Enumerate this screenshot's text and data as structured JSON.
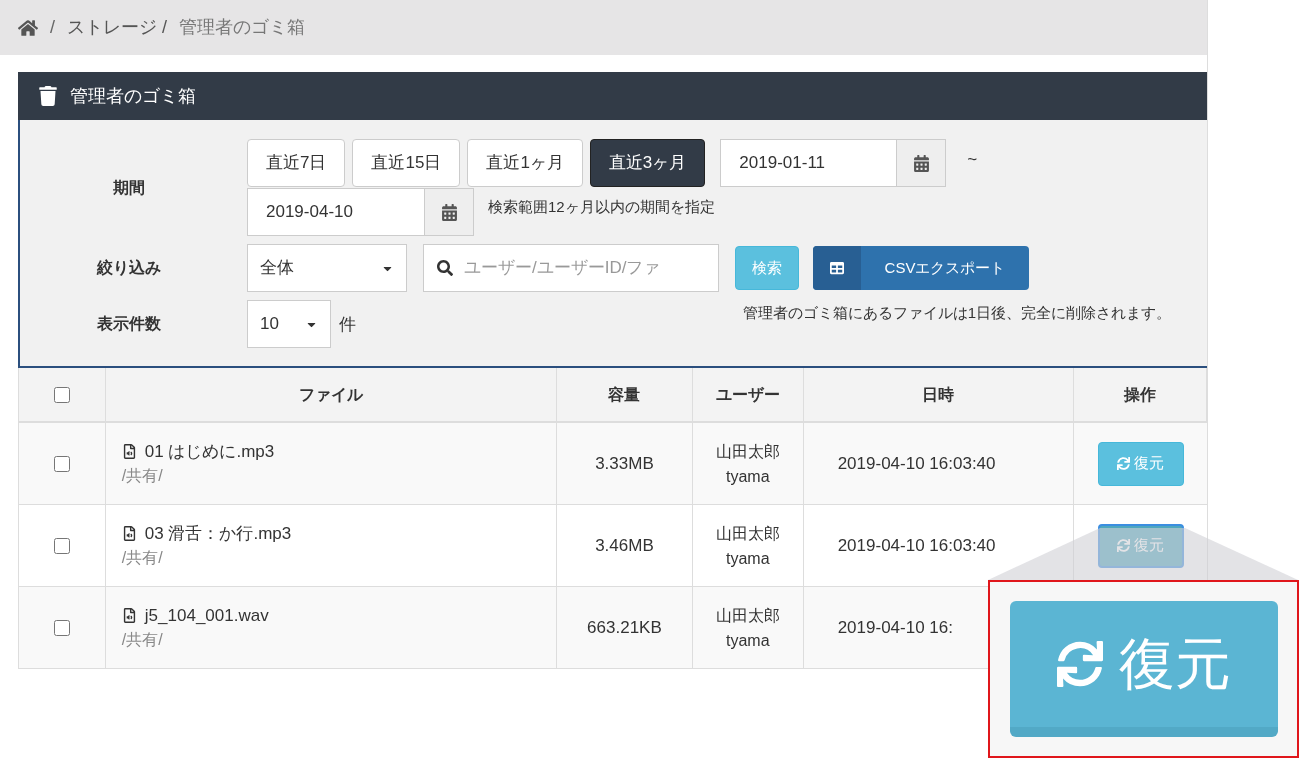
{
  "home_separator": "/",
  "breadcrumb": [
    "ストレージ /",
    "管理者のゴミ箱"
  ],
  "panel": {
    "title": "管理者のゴミ箱"
  },
  "filters": {
    "period_label": "期間",
    "period_buttons": [
      {
        "label": "直近7日",
        "selected": false
      },
      {
        "label": "直近15日",
        "selected": false
      },
      {
        "label": "直近1ヶ月",
        "selected": false
      },
      {
        "label": "直近3ヶ月",
        "selected": true
      }
    ],
    "date_from": "2019-01-11",
    "range_separator": "~",
    "date_to": "2019-04-10",
    "range_hint": "検索範囲12ヶ月以内の期間を指定",
    "narrow_label": "絞り込み",
    "narrow_value": "全体",
    "search_placeholder": "ユーザー/ユーザーID/ファ",
    "search_button": "検索",
    "csv_button": "CSVエクスポート",
    "count_label": "表示件数",
    "count_value": "10",
    "count_unit": "件",
    "notice": "管理者のゴミ箱にあるファイルは1日後、完全に削除されます。"
  },
  "table": {
    "columns": [
      "ファイル",
      "容量",
      "ユーザー",
      "日時",
      "操作"
    ],
    "header_checked": false,
    "rows": [
      {
        "checked": false,
        "file": "01 はじめに.mp3",
        "folder": "/共有/",
        "size": "3.33MB",
        "user_name": "山田太郎",
        "user_id": "tyama",
        "datetime": "2019-04-10 16:03:40",
        "restore": {
          "label": "復元",
          "hovered": false
        }
      },
      {
        "checked": false,
        "file": "03 滑舌：か行.mp3",
        "folder": "/共有/",
        "size": "3.46MB",
        "user_name": "山田太郎",
        "user_id": "tyama",
        "datetime": "2019-04-10 16:03:40",
        "restore": {
          "label": "復元",
          "hovered": true
        }
      },
      {
        "checked": false,
        "file": "j5_104_001.wav",
        "folder": "/共有/",
        "size": "663.21KB",
        "user_name": "山田太郎",
        "user_id": "tyama",
        "datetime": "2019-04-10 16:"
      }
    ]
  },
  "callout": {
    "label": "復元"
  }
}
